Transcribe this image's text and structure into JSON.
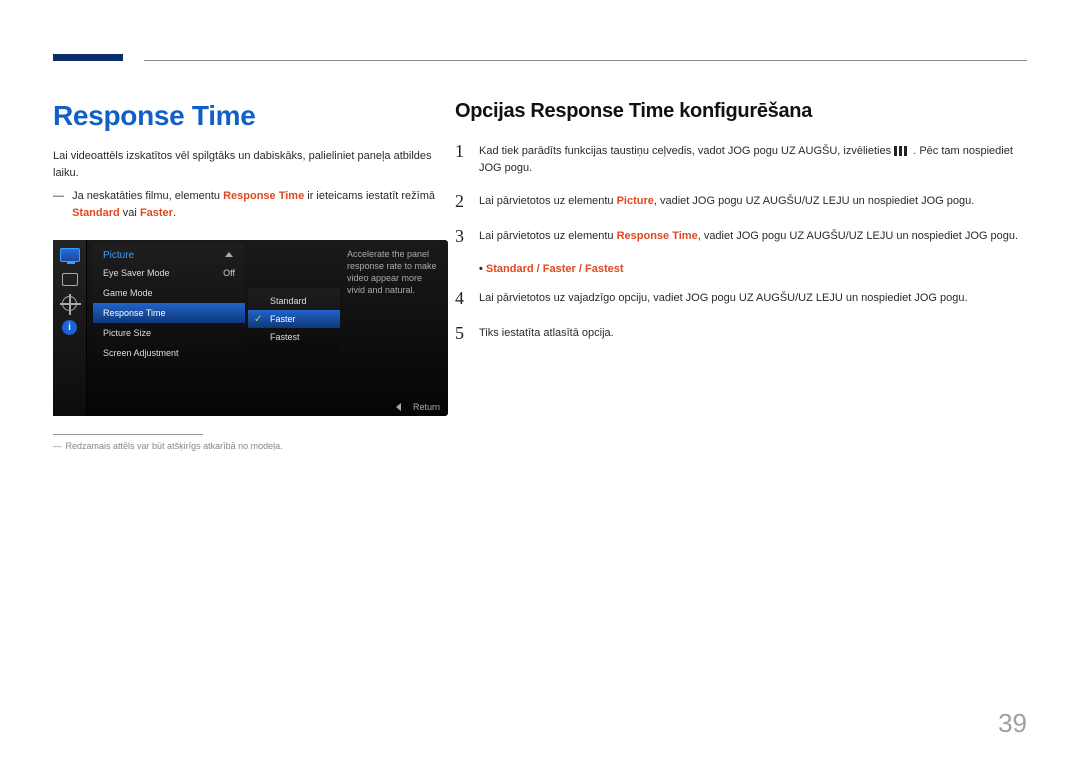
{
  "page_number": "39",
  "left": {
    "heading": "Response Time",
    "intro": "Lai videoattēls izskatītos vēl spilgtāks un dabiskāks, palieliniet paneļa atbildes laiku.",
    "note_prefix": "Ja neskatāties filmu, elementu ",
    "note_item": "Response Time",
    "note_middle": " ir ieteicams iestatīt režīmā ",
    "note_std": "Standard",
    "note_or": " vai ",
    "note_faster": "Faster",
    "note_end": ".",
    "footnote": "Redzamais attēls var būt atšķirīgs atkarībā no modeļa."
  },
  "osd": {
    "title": "Picture",
    "items": [
      {
        "label": "Eye Saver Mode",
        "value": "Off"
      },
      {
        "label": "Game Mode",
        "value": ""
      },
      {
        "label": "Response Time",
        "value": ""
      },
      {
        "label": "Picture Size",
        "value": ""
      },
      {
        "label": "Screen Adjustment",
        "value": ""
      }
    ],
    "sub": [
      "Standard",
      "Faster",
      "Fastest"
    ],
    "description": "Accelerate the panel response rate to make video appear more vivid and natural.",
    "return": "Return"
  },
  "right": {
    "heading": "Opcijas Response Time konfigurēšana",
    "step1_a": "Kad tiek parādīts funkcijas taustiņu ceļvedis, vadot JOG pogu UZ AUGŠU, izvēlieties ",
    "step1_b": ". Pēc tam nospiediet JOG pogu.",
    "step2_a": "Lai pārvietotos uz elementu ",
    "step2_item": "Picture",
    "step2_b": ", vadiet JOG pogu UZ AUGŠU/UZ LEJU un nospiediet JOG pogu.",
    "step3_a": "Lai pārvietotos uz elementu ",
    "step3_item": "Response Time",
    "step3_b": ", vadiet JOG pogu UZ AUGŠU/UZ LEJU un nospiediet JOG pogu.",
    "bullet_a": "Standard",
    "bullet_sep": " / ",
    "bullet_b": "Faster",
    "bullet_c": "Fastest",
    "step4": "Lai pārvietotos uz vajadzīgo opciju, vadiet JOG pogu UZ AUGŠU/UZ LEJU un nospiediet JOG pogu.",
    "step5": "Tiks iestatīta atlasītā opcija."
  }
}
